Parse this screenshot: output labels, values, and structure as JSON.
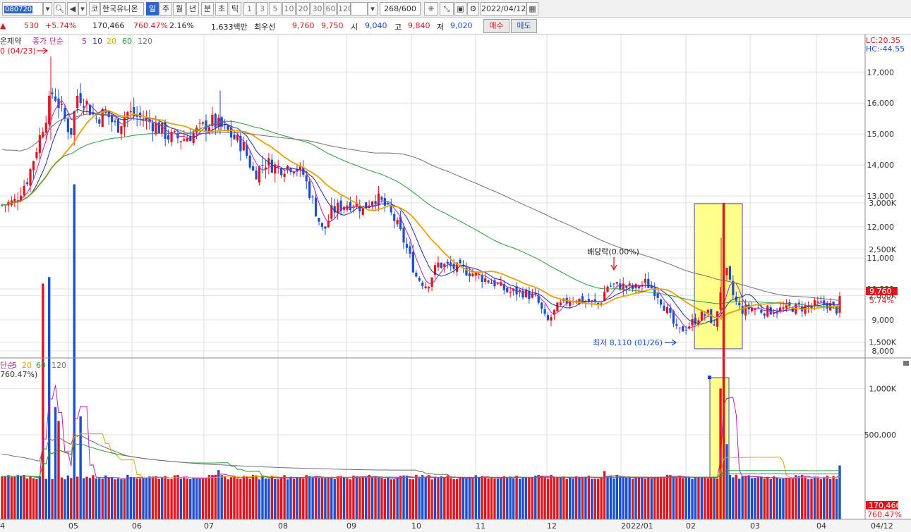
{
  "toolbar": {
    "stock_code": "080720",
    "market_label": "코",
    "stock_name": "한국유니온",
    "periods": [
      "일",
      "주",
      "월",
      "년",
      "분",
      "초",
      "틱"
    ],
    "selected_period": "일",
    "intervals": [
      "1",
      "3",
      "5",
      "10",
      "20",
      "30",
      "60",
      "120"
    ],
    "count": "268",
    "count_total": "/600",
    "date": "2022/04/12"
  },
  "quote": {
    "change": "530",
    "change_rate": "+5.74%",
    "volume": "170,466",
    "volume_rate": "760.47%",
    "turnover": "2.16%",
    "amount": "1,633백만",
    "best_bid_label": "최우선",
    "ask": "9,760",
    "bid": "9,750",
    "open_label": "시",
    "open": "9,040",
    "high_label": "고",
    "high": "9,840",
    "low_label": "저",
    "low": "9,020",
    "buy_label": "매수",
    "sell_label": "매도"
  },
  "chart": {
    "price_legend_name": "온제약",
    "price_legend_items": [
      "종가 단순",
      "5",
      "10",
      "20",
      "60",
      "120"
    ],
    "high_marker": "0 (04/23)",
    "lc_label": "LC:20.35",
    "hc_label": "HC:-44.55",
    "current_price": "9,760",
    "current_rate": "5.74%",
    "dividend_label": "배당락(0.00%)",
    "low_marker": "최저 8,110 (01/26)",
    "price_axis": [
      {
        "label": "17,000",
        "value": 17000
      },
      {
        "label": "16,000",
        "value": 16000
      },
      {
        "label": "15,000",
        "value": 15000
      },
      {
        "label": "14,000",
        "value": 14000
      },
      {
        "label": "13,000",
        "value": 13000
      },
      {
        "label": "12,000",
        "value": 12000
      },
      {
        "label": "11,000",
        "value": 11000
      },
      {
        "label": "10,000",
        "value": 10000
      },
      {
        "label": "9,000",
        "value": 9000
      },
      {
        "label": "8,000",
        "value": 8000
      }
    ],
    "volume_legend_items": [
      "단순",
      "5",
      "20",
      "60",
      "120"
    ],
    "volume_legend_rate": "760.47%)",
    "volume_axis": [
      {
        "label": "3,000K",
        "value": 3000
      },
      {
        "label": "2,500K",
        "value": 2500
      },
      {
        "label": "2,000K",
        "value": 2000
      },
      {
        "label": "1,500K",
        "value": 1500
      },
      {
        "label": "1,000K",
        "value": 1000
      },
      {
        "label": "500,000",
        "value": 500
      }
    ],
    "current_volume": "170,466",
    "current_volume_rate": "760.47%",
    "month_labels": [
      "4",
      "05",
      "06",
      "07",
      "08",
      "09",
      "10",
      "11",
      "12",
      "2022/01",
      "02",
      "03",
      "04"
    ],
    "last_date": "04/12"
  },
  "colors": {
    "up": "#e0161d",
    "down": "#1a4fd0",
    "ma5": "#b522b5",
    "ma10": "#1c2fa8",
    "ma20": "#e8a200",
    "ma60": "#2a9a3a",
    "ma120": "#707070",
    "highlight": "#ffff8c"
  }
}
